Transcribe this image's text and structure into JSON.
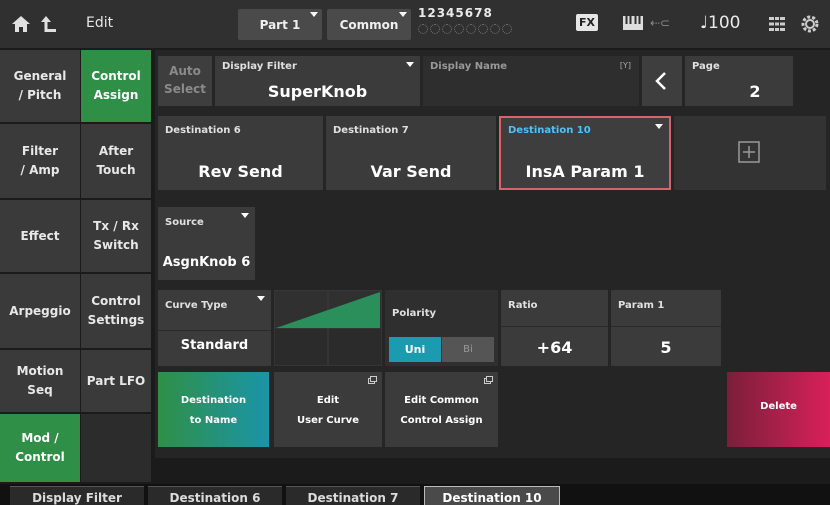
{
  "topbar": {
    "title": "Edit",
    "part": "Part 1",
    "common": "Common",
    "part_numbers": "12345678",
    "fx": "FX",
    "tempo": "♩100"
  },
  "nav_left": [
    {
      "label": "General\n/ Pitch"
    },
    {
      "label": "Filter\n/ Amp"
    },
    {
      "label": "Effect"
    },
    {
      "label": "Arpeggio"
    },
    {
      "label": "Motion\nSeq"
    },
    {
      "label": "Mod /\nControl"
    }
  ],
  "nav_right": [
    {
      "label": "Control\nAssign"
    },
    {
      "label": "After\nTouch"
    },
    {
      "label": "Tx / Rx\nSwitch"
    },
    {
      "label": "Control\nSettings"
    },
    {
      "label": "Part LFO"
    }
  ],
  "header": {
    "auto_select": "Auto\nSelect",
    "display_filter_label": "Display Filter",
    "display_filter_value": "SuperKnob",
    "display_name_label": "Display Name",
    "display_name_marker": "[Y]",
    "page_label": "Page",
    "page_value": "2"
  },
  "destinations": [
    {
      "label": "Destination 6",
      "value": "Rev Send"
    },
    {
      "label": "Destination 7",
      "value": "Var Send"
    },
    {
      "label": "Destination 10",
      "value": "InsA Param 1"
    }
  ],
  "source": {
    "label": "Source",
    "value": "AsgnKnob 6"
  },
  "curve": {
    "label": "Curve Type",
    "value": "Standard"
  },
  "polarity": {
    "label": "Polarity",
    "uni": "Uni",
    "bi": "Bi"
  },
  "ratio": {
    "label": "Ratio",
    "value": "+64"
  },
  "param1": {
    "label": "Param 1",
    "value": "5"
  },
  "actions": {
    "dest_to_name": "Destination\nto Name",
    "edit_user_curve": "Edit\nUser Curve",
    "edit_common": "Edit Common\nControl Assign",
    "delete": "Delete"
  },
  "bottom_tabs": [
    "Display Filter",
    "Destination 6",
    "Destination 7",
    "Destination 10"
  ],
  "colors": {
    "active_green": "#2f8f47",
    "dest_selected_border": "#d9626b",
    "dest_selected_label": "#4fc3f7",
    "polarity_uni": "#1a9bb0",
    "delete_gradient_start": "#7a1f3a",
    "delete_gradient_end": "#d8205a"
  }
}
